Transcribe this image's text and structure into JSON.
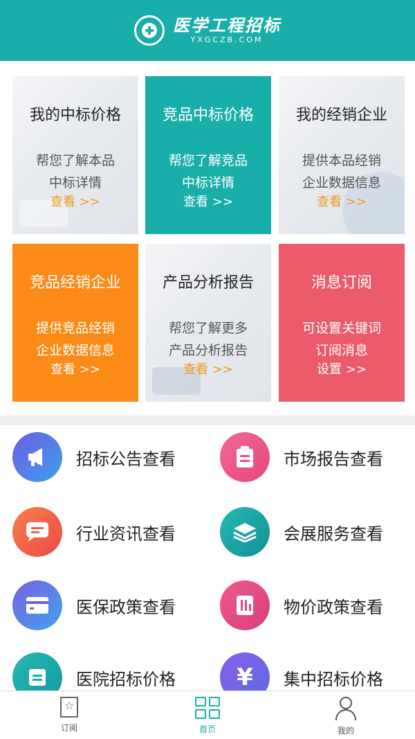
{
  "header": {
    "brand_name": "医学工程招标",
    "domain": "YXGCZB.COM"
  },
  "cards": [
    {
      "title": "我的中标价格",
      "desc1": "帮您了解本品",
      "desc2": "中标详情",
      "link": "查看 >>"
    },
    {
      "title": "竞品中标价格",
      "desc1": "帮您了解竞品",
      "desc2": "中标详情",
      "link": "查看 >>"
    },
    {
      "title": "我的经销企业",
      "desc1": "提供本品经销",
      "desc2": "企业数据信息",
      "link": "查看 >>"
    },
    {
      "title": "竞品经销企业",
      "desc1": "提供竞品经销",
      "desc2": "企业数据信息",
      "link": "查看 >>"
    },
    {
      "title": "产品分析报告",
      "desc1": "帮您了解更多",
      "desc2": "产品分析报告",
      "link": "查看 >>"
    },
    {
      "title": "消息订阅",
      "desc1": "可设置关键词",
      "desc2": "订阅消息",
      "link": "设置 >>"
    }
  ],
  "menu": [
    {
      "label": "招标公告查看",
      "icon": "megaphone-icon",
      "color": "#4a7bea"
    },
    {
      "label": "市场报告查看",
      "icon": "clipboard-icon",
      "color": "#ec4f86"
    },
    {
      "label": "行业资讯查看",
      "icon": "message-icon",
      "color": "#f2614a"
    },
    {
      "label": "会展服务查看",
      "icon": "layers-icon",
      "color": "#1aaeaa"
    },
    {
      "label": "医保政策查看",
      "icon": "card-icon",
      "color": "#6a63e2"
    },
    {
      "label": "物价政策查看",
      "icon": "document-icon",
      "color": "#e8478a"
    },
    {
      "label": "医院招标价格",
      "icon": "list-icon",
      "color": "#1aaeaa"
    },
    {
      "label": "集中招标价格",
      "icon": "yuan-icon",
      "color": "#7a5fe0"
    }
  ],
  "tabbar": [
    {
      "label": "订阅",
      "icon": "star-bookmark-icon"
    },
    {
      "label": "首页",
      "icon": "grid-icon"
    },
    {
      "label": "我的",
      "icon": "user-icon"
    }
  ]
}
